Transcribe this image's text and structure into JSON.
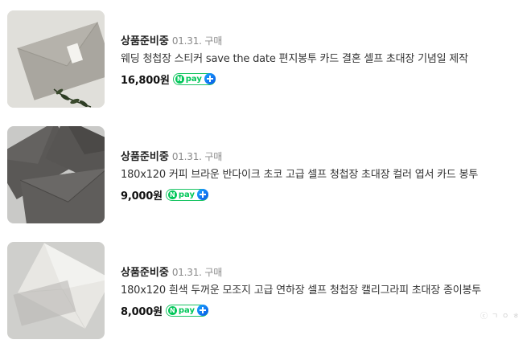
{
  "orders": [
    {
      "status": "상품준비중",
      "date": "01.31. 구매",
      "title": "웨딩 청첩장 스티커 save the date 편지봉투 카드 결혼 셀프 초대장 기념일 제작",
      "price": "16,800원",
      "thumbnail": "gray-envelope-with-leaf-photo"
    },
    {
      "status": "상품준비중",
      "date": "01.31. 구매",
      "title": "180x120 커피 브라운 반다이크 초코 고급 셀프 청첩장 초대장 컬러 엽서 카드 봉투",
      "price": "9,000원",
      "thumbnail": "dark-brown-envelopes-photo"
    },
    {
      "status": "상품준비중",
      "date": "01.31. 구매",
      "title": "180x120 흰색 두꺼운 모조지 고급 연하장 셀프 청첩장 캘리그라피 초대장 종이봉투",
      "price": "8,000원",
      "thumbnail": "white-envelope-photo"
    }
  ],
  "npay_badge": {
    "label": "pay",
    "n_mark": "N",
    "plus_icon": "plus-icon"
  },
  "watermark": "ⓒ ㄱ ㅇ ㅎ",
  "colors": {
    "npay_green": "#03c75a",
    "npay_blue": "#0a57e6",
    "text": "#333333",
    "muted": "#8a8a8a"
  }
}
